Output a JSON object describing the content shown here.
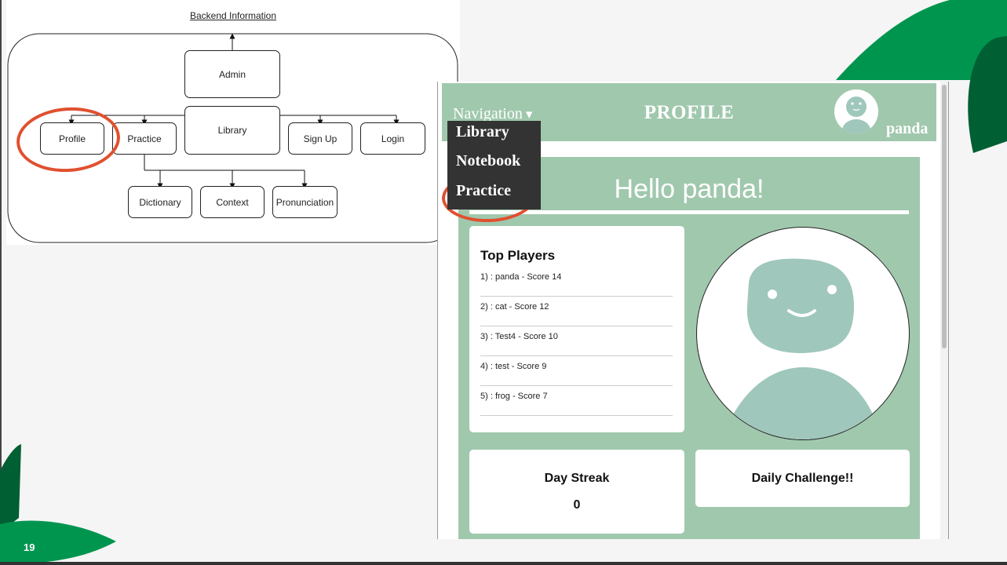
{
  "diagram": {
    "title": "Backend Information",
    "nodes": {
      "admin": "Admin",
      "library": "Library",
      "profile": "Profile",
      "practice": "Practice",
      "signup": "Sign Up",
      "login": "Login",
      "dictionary": "Dictionary",
      "context": "Context",
      "pronunciation": "Pronunciation"
    }
  },
  "app": {
    "navbar": {
      "nav_label": "Navigation",
      "nav_caret": "▾",
      "page_title": "PROFILE",
      "username": "panda"
    },
    "dropdown": {
      "items": [
        "Library",
        "Notebook",
        "Practice"
      ]
    },
    "greeting": "Hello panda!",
    "top_players": {
      "title": "Top Players",
      "rows": [
        "1) : panda - Score 14",
        "2) : cat - Score 12",
        "3) : Test4 - Score 10",
        "4) : test - Score 9",
        "5) : frog - Score 7"
      ]
    },
    "day_streak": {
      "title": "Day Streak",
      "value": "0"
    },
    "daily_challenge": {
      "title": "Daily Challenge!!"
    }
  },
  "slide": {
    "page_number": "19"
  },
  "colors": {
    "accent_green": "#a0c8ad",
    "avatar_teal": "#9fc7bb",
    "highlight_ring": "#e0502f",
    "slide_green": "#00954f",
    "slide_dark_green": "#005f33",
    "dropdown_bg": "#333333"
  },
  "icons": {
    "nav_caret": "chevron-down-icon",
    "avatar": "user-avatar-icon"
  }
}
